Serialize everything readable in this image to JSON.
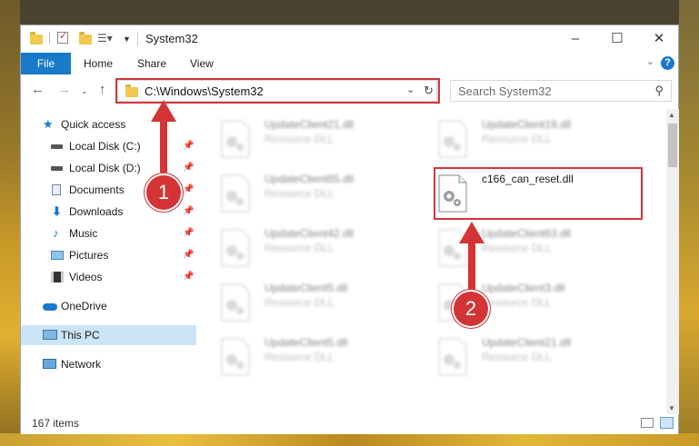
{
  "window": {
    "title": "System32",
    "minimize": "–",
    "maximize": "☐",
    "close": "✕"
  },
  "ribbon": {
    "tabs": [
      "File",
      "Home",
      "Share",
      "View"
    ],
    "help": "?"
  },
  "nav": {
    "address": "C:\\Windows\\System32",
    "search_placeholder": "Search System32"
  },
  "sidebar": {
    "items": [
      {
        "label": "Quick access",
        "icon": "star-icon"
      },
      {
        "label": "Local Disk (C:)",
        "icon": "drive-icon"
      },
      {
        "label": "Local Disk (D:)",
        "icon": "drive-icon"
      },
      {
        "label": "Documents",
        "icon": "documents-icon"
      },
      {
        "label": "Downloads",
        "icon": "downloads-icon"
      },
      {
        "label": "Music",
        "icon": "music-icon"
      },
      {
        "label": "Pictures",
        "icon": "pictures-icon"
      },
      {
        "label": "Videos",
        "icon": "videos-icon"
      },
      {
        "label": "OneDrive",
        "icon": "cloud-icon"
      },
      {
        "label": "This PC",
        "icon": "computer-icon"
      },
      {
        "label": "Network",
        "icon": "network-icon"
      }
    ]
  },
  "files": [
    {
      "name": "UpdateClient21.dll",
      "type": "Resource DLL"
    },
    {
      "name": "UpdateClient19.dll",
      "type": "Resource DLL"
    },
    {
      "name": "UpdateClient65.dll",
      "type": "Resource DLL"
    },
    {
      "name": "c166_can_reset.dll",
      "type": ""
    },
    {
      "name": "UpdateClient42.dll",
      "type": "Resource DLL"
    },
    {
      "name": "UpdateClient63.dll",
      "type": "Resource DLL"
    },
    {
      "name": "UpdateClient5.dll",
      "type": "Resource DLL"
    },
    {
      "name": "UpdateClient3.dll",
      "type": "Resource DLL"
    },
    {
      "name": "UpdateClient5.dll",
      "type": "Resource DLL"
    },
    {
      "name": "UpdateClient21.dll",
      "type": "Resource DLL"
    }
  ],
  "status": {
    "count": "167 items"
  },
  "callouts": [
    "1",
    "2"
  ],
  "colors": {
    "accent": "#1979ca",
    "highlight_red": "#d3373a",
    "selected_bg": "#cce4f7"
  }
}
